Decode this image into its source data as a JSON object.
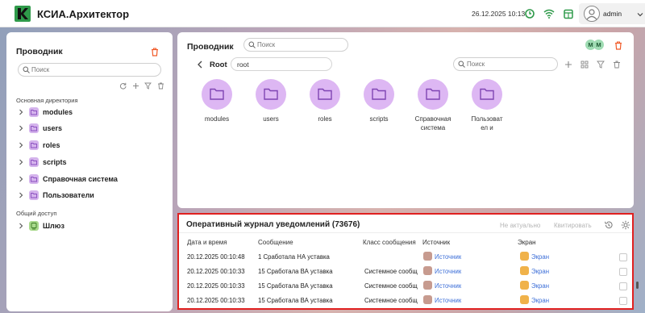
{
  "header": {
    "app_title": "КСИА.Архитектор",
    "datetime": "26.12.2025 10:13",
    "user_name": "admin",
    "icons": [
      "clock-icon",
      "wifi-icon",
      "calendar-icon",
      "user-icon",
      "chevron-down-icon"
    ]
  },
  "left_panel": {
    "title": "Проводник",
    "search_placeholder": "Поиск",
    "section_main": "Основная директория",
    "items": [
      {
        "label": "modules"
      },
      {
        "label": "users"
      },
      {
        "label": "roles"
      },
      {
        "label": "scripts"
      },
      {
        "label": "Справочная система"
      },
      {
        "label": "Пользователи"
      }
    ],
    "section_shared": "Общий доступ",
    "shared_items": [
      {
        "label": "Шлюз"
      }
    ]
  },
  "explorer": {
    "title": "Проводник",
    "search_placeholder": "Поиск",
    "badges": [
      "M",
      "M"
    ],
    "path_root": "Root",
    "path_value": "root",
    "filter_placeholder": "Поиск",
    "folders": [
      {
        "name": "modules"
      },
      {
        "name": "users"
      },
      {
        "name": "roles"
      },
      {
        "name": "scripts"
      },
      {
        "name": "Справочная система"
      },
      {
        "name": "Пользовател и"
      }
    ]
  },
  "journal": {
    "title": "Оперативный журнал уведомлений (73676)",
    "action_not_actual": "Не актуально",
    "action_ack": "Квитировать",
    "columns": [
      "Дата и время",
      "Сообщение",
      "Класс сообщения",
      "Источник",
      "Экран"
    ],
    "rows": [
      {
        "datetime": "20.12.2025 00:10:48",
        "message": "1 Сработала НА уставка",
        "class": "",
        "source": "Источник",
        "screen": "Экран"
      },
      {
        "datetime": "20.12.2025 00:10:33",
        "message": "15 Сработала ВА уставка",
        "class": "Системное сообщ...",
        "source": "Источник",
        "screen": "Экран"
      },
      {
        "datetime": "20.12.2025 00:10:33",
        "message": "15 Сработала ВА уставка",
        "class": "Системное сообщ...",
        "source": "Источник",
        "screen": "Экран"
      },
      {
        "datetime": "20.12.2025 00:10:33",
        "message": "15 Сработала ВА уставка",
        "class": "Системное сообщ...",
        "source": "Источник",
        "screen": "Экран"
      }
    ]
  },
  "colors": {
    "accent_orange": "#f05a28",
    "folder_purple": "#ddb7f3",
    "link_blue": "#3d6fd8",
    "highlight_red": "#e02020"
  }
}
